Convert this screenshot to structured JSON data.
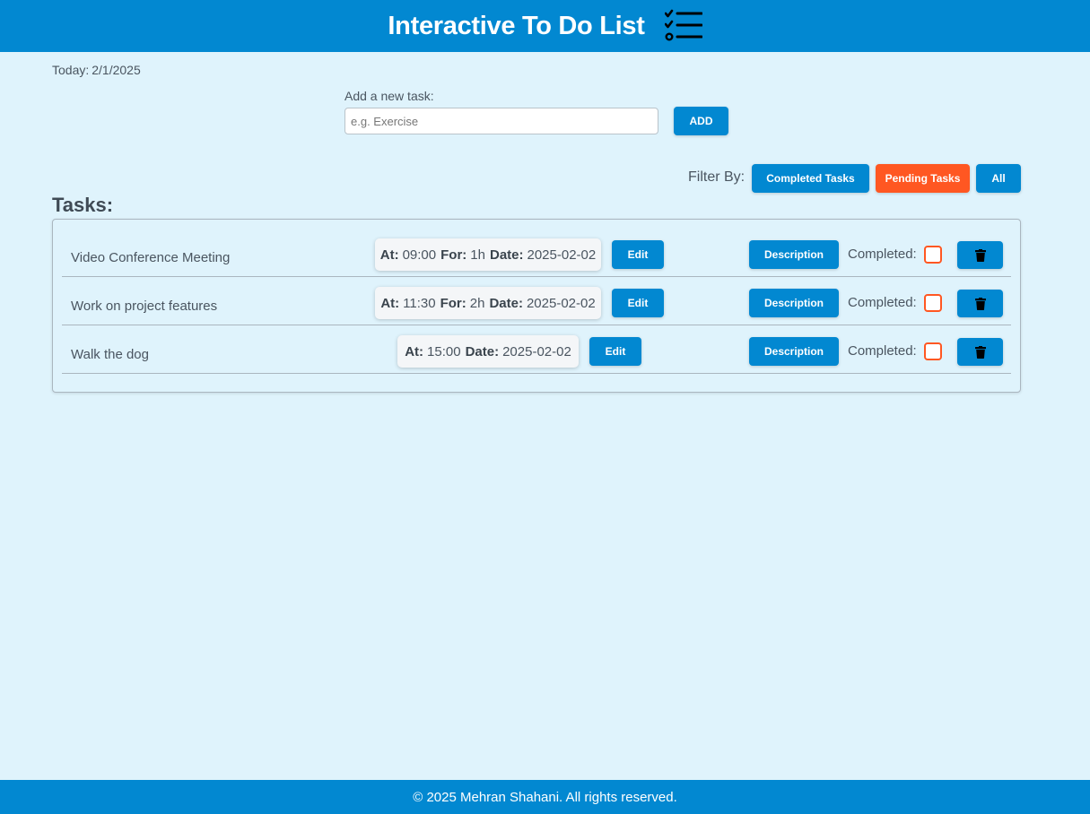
{
  "header": {
    "title": "Interactive To Do List",
    "icon": "checklist-icon"
  },
  "today": {
    "label": "Today:",
    "date": "2/1/2025"
  },
  "add_task": {
    "label": "Add a new task:",
    "placeholder": "e.g. Exercise",
    "button_label": "ADD"
  },
  "filter": {
    "label": "Filter By:",
    "completed_label": "Completed Tasks",
    "pending_label": "Pending Tasks",
    "all_label": "All",
    "active": "Pending Tasks"
  },
  "tasks": {
    "heading": "Tasks:",
    "items": [
      {
        "name": "Video Conference Meeting",
        "at_label": "At:",
        "at": "09:00",
        "for_label": "For:",
        "for": "1h",
        "date_label": "Date:",
        "date": "2025-02-02",
        "edit_label": "Edit",
        "description_label": "Description",
        "completed_label": "Completed:",
        "completed": false
      },
      {
        "name": "Work on project features",
        "at_label": "At:",
        "at": "11:30",
        "for_label": "For:",
        "for": "2h",
        "date_label": "Date:",
        "date": "2025-02-02",
        "edit_label": "Edit",
        "description_label": "Description",
        "completed_label": "Completed:",
        "completed": false
      },
      {
        "name": "Walk the dog",
        "at_label": "At:",
        "at": "15:00",
        "date_label": "Date:",
        "date": "2025-02-02",
        "edit_label": "Edit",
        "description_label": "Description",
        "completed_label": "Completed:",
        "completed": false
      }
    ]
  },
  "footer": {
    "text": "© 2025 Mehran Shahani. All rights reserved."
  },
  "colors": {
    "primary": "#0288d1",
    "accent": "#ff5722",
    "background": "#dff3fc"
  }
}
